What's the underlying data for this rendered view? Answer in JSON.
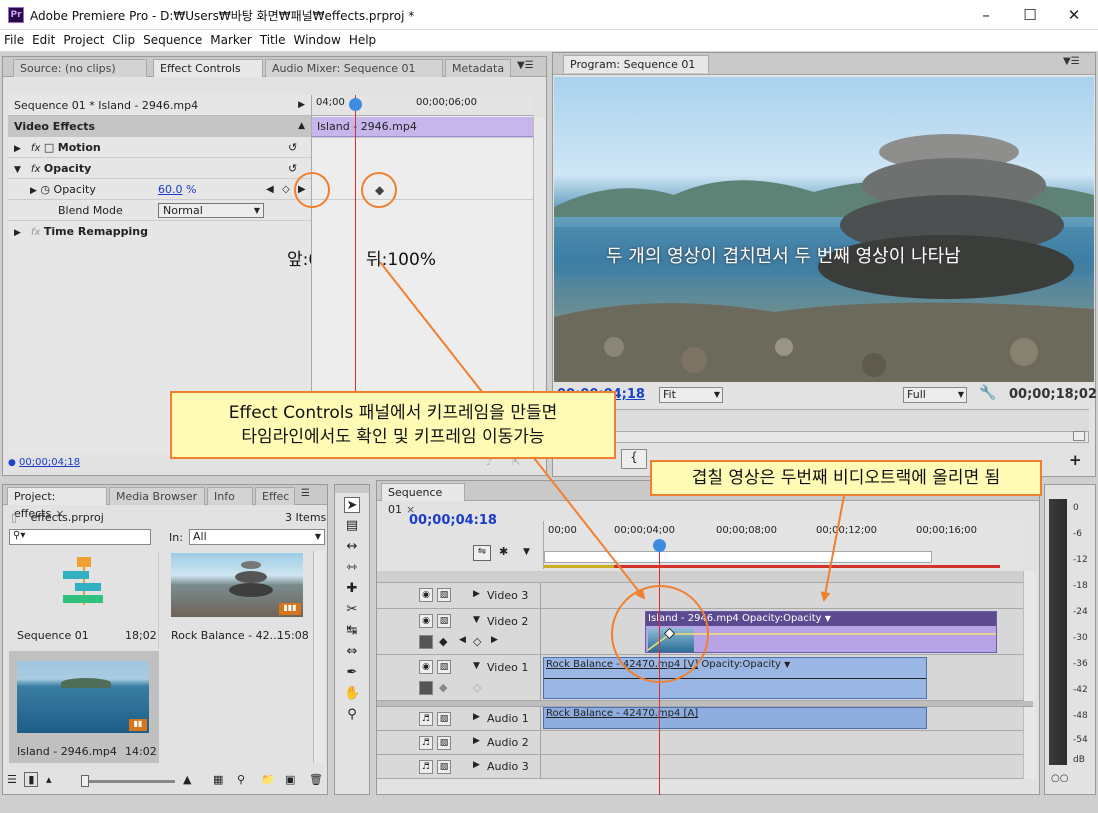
{
  "titlebar": {
    "title": "Adobe Premiere Pro - D:₩Users₩바탕 화면₩패널₩effects.prproj *",
    "icon": "Pr"
  },
  "menu": [
    "File",
    "Edit",
    "Project",
    "Clip",
    "Sequence",
    "Marker",
    "Title",
    "Window",
    "Help"
  ],
  "source_panel": {
    "tabs": [
      "Source: (no clips)",
      "Effect Controls",
      "Audio Mixer: Sequence 01",
      "Metadata"
    ],
    "seq_label": "Sequence 01 * Island - 2946.mp4",
    "ruler_start": "04;00",
    "ruler_mid": "00;00;06;00",
    "clip_bar": "Island - 2946.mp4",
    "video_effects": "Video Effects",
    "motion": "Motion",
    "opacity_group": "Opacity",
    "opacity": "Opacity",
    "opacity_value": "60.0",
    "opacity_unit": "%",
    "blend_mode": "Blend Mode",
    "blend_value": "Normal",
    "time_remapping": "Time Remapping",
    "timecode": "00;00;04;18",
    "annot_before": "앞:0%",
    "annot_after": "뒤:100%"
  },
  "program": {
    "tab": "Program: Sequence 01",
    "caption": "두 개의 영상이 겹치면서 두 번째 영상이 나타남",
    "timecode_left": "00;00;04;18",
    "fit": "Fit",
    "quality": "Full",
    "timecode_right": "00;00;18;02"
  },
  "project": {
    "tabs": [
      "Project: effects",
      "Media Browser",
      "Info",
      "Effec"
    ],
    "file": "effects.prproj",
    "items_count": "3 Items",
    "in_label": "In:",
    "in_value": "All",
    "items": [
      {
        "name": "Sequence 01",
        "duration": "18;02"
      },
      {
        "name": "Rock Balance - 42...",
        "duration": "15:08"
      },
      {
        "name": "Island - 2946.mp4",
        "duration": "14:02"
      }
    ]
  },
  "timeline": {
    "tab": "Sequence 01",
    "timecode": "00;00;04:18",
    "ruler": [
      "00;00",
      "00;00;04;00",
      "00;00;08;00",
      "00;00;12;00",
      "00;00;16;00"
    ],
    "tracks": {
      "v3": "Video 3",
      "v2": "Video 2",
      "v1": "Video 1",
      "a1": "Audio 1",
      "a2": "Audio 2",
      "a3": "Audio 3"
    },
    "clip_v2": "Island - 2946.mp4",
    "clip_v2_fx": "Opacity:Opacity",
    "clip_v1": "Rock Balance - 42470.mp4 [V]",
    "clip_v1_fx": "Opacity:Opacity",
    "clip_a1": "Rock Balance - 42470.mp4 [A]"
  },
  "meters": [
    "0",
    "-6",
    "-12",
    "-18",
    "-24",
    "-30",
    "-36",
    "-42",
    "-48",
    "-54",
    "dB"
  ],
  "callouts": {
    "effect_line1": "Effect Controls 패널에서 키프레임을 만들면",
    "effect_line2": "타임라인에서도 확인 및 키프레임 이동가능",
    "overlap": "겹칠 영상은 두번째 비디오트랙에 올리면 됨"
  },
  "colors": {
    "accent_orange": "#f08030",
    "clip_purple": "#b9a6e8",
    "clip_blue": "#8eaee0",
    "callout_bg": "#fffbb4"
  }
}
